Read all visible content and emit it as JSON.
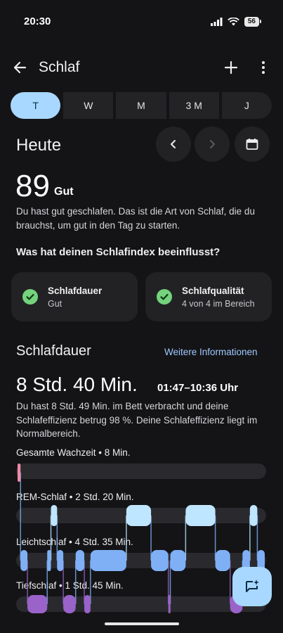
{
  "status": {
    "time": "20:30",
    "battery": "56"
  },
  "appbar": {
    "title": "Schlaf"
  },
  "tabs": [
    {
      "label": "T",
      "selected": true
    },
    {
      "label": "W"
    },
    {
      "label": "M"
    },
    {
      "label": "3 M"
    },
    {
      "label": "J"
    }
  ],
  "day": {
    "title": "Heute"
  },
  "score": {
    "value": "89",
    "rating": "Gut",
    "description": "Du hast gut geschlafen. Das ist die Art von Schlaf, die du brauchst, um gut in den Tag zu starten.",
    "question": "Was hat deinen Schlafindex beeinflusst?"
  },
  "cards": [
    {
      "title": "Schlafdauer",
      "subtitle": "Gut"
    },
    {
      "title": "Schlafqualität",
      "subtitle": "4 von 4 im Bereich"
    }
  ],
  "duration": {
    "section_title": "Schlafdauer",
    "more_link": "Weitere Informationen",
    "total": "8 Std. 40 Min.",
    "range": "01:47–10:36 Uhr",
    "description": "Du hast 8 Std. 49 Min. im Bett verbracht und deine Schlafeffizienz betrug 98 %. Deine Schlafeffizienz liegt im Normalbereich."
  },
  "stages": [
    {
      "label": "Gesamte Wachzeit • 8 Min.",
      "color": "#f08aa6"
    },
    {
      "label": "REM-Schlaf • 2 Std. 20 Min.",
      "color": "#bfe6ff"
    },
    {
      "label": "Leichtschlaf • 4 Std. 35 Min.",
      "color": "#7fb0f5"
    },
    {
      "label": "Tiefschlaf • 1 Std. 45 Min.",
      "color": "#9a63c9"
    }
  ],
  "hypnogram": {
    "start": "01:47",
    "end": "10:36",
    "segments": [
      {
        "stage": 0,
        "from": 0.0,
        "to": 0.012
      },
      {
        "stage": 2,
        "from": 0.012,
        "to": 0.04
      },
      {
        "stage": 3,
        "from": 0.04,
        "to": 0.12
      },
      {
        "stage": 2,
        "from": 0.12,
        "to": 0.135
      },
      {
        "stage": 1,
        "from": 0.135,
        "to": 0.16
      },
      {
        "stage": 2,
        "from": 0.16,
        "to": 0.185
      },
      {
        "stage": 3,
        "from": 0.185,
        "to": 0.235
      },
      {
        "stage": 2,
        "from": 0.235,
        "to": 0.27
      },
      {
        "stage": 3,
        "from": 0.27,
        "to": 0.295
      },
      {
        "stage": 2,
        "from": 0.295,
        "to": 0.44
      },
      {
        "stage": 1,
        "from": 0.44,
        "to": 0.54
      },
      {
        "stage": 2,
        "from": 0.54,
        "to": 0.61
      },
      {
        "stage": 3,
        "from": 0.61,
        "to": 0.618
      },
      {
        "stage": 2,
        "from": 0.618,
        "to": 0.68
      },
      {
        "stage": 1,
        "from": 0.68,
        "to": 0.8
      },
      {
        "stage": 2,
        "from": 0.8,
        "to": 0.86
      },
      {
        "stage": 3,
        "from": 0.86,
        "to": 0.91
      },
      {
        "stage": 2,
        "from": 0.91,
        "to": 0.94
      },
      {
        "stage": 1,
        "from": 0.94,
        "to": 0.97
      },
      {
        "stage": 2,
        "from": 0.97,
        "to": 1.0
      }
    ]
  },
  "icons": {
    "back": "arrow-back-icon",
    "add": "plus-icon",
    "more": "more-vert-icon",
    "prev": "chevron-left-icon",
    "next": "chevron-right-icon",
    "calendar": "calendar-icon",
    "check": "check-circle-icon",
    "fab": "sparkle-chat-icon"
  },
  "colors": {
    "accent": "#a8d8ff",
    "check": "#74d37c",
    "link": "#9fc8ff"
  }
}
